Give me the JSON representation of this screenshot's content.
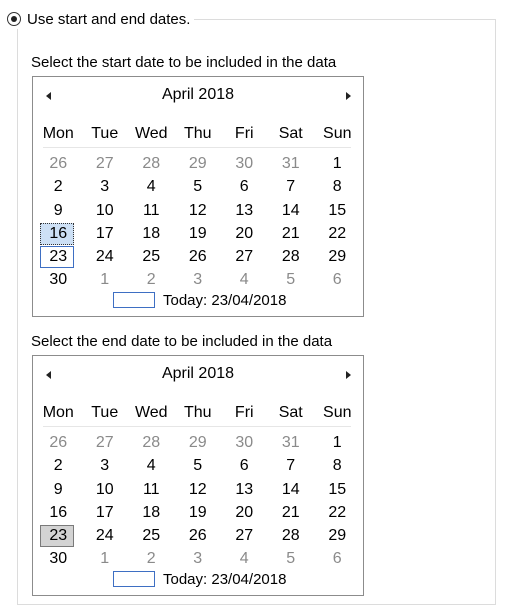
{
  "option": {
    "label": "Use start and end dates."
  },
  "start": {
    "label": "Select the start date to be included in the data",
    "month_title": "April 2018",
    "selected": "16",
    "today_text": "Today: 23/04/2018"
  },
  "end": {
    "label": "Select the end date to be included in the data",
    "month_title": "April 2018",
    "selected": "23",
    "today_text": "Today: 23/04/2018"
  },
  "weekdays": [
    "Mon",
    "Tue",
    "Wed",
    "Thu",
    "Fri",
    "Sat",
    "Sun"
  ],
  "weeks": [
    [
      "26",
      "27",
      "28",
      "29",
      "30",
      "31",
      "1"
    ],
    [
      "2",
      "3",
      "4",
      "5",
      "6",
      "7",
      "8"
    ],
    [
      "9",
      "10",
      "11",
      "12",
      "13",
      "14",
      "15"
    ],
    [
      "16",
      "17",
      "18",
      "19",
      "20",
      "21",
      "22"
    ],
    [
      "23",
      "24",
      "25",
      "26",
      "27",
      "28",
      "29"
    ],
    [
      "30",
      "1",
      "2",
      "3",
      "4",
      "5",
      "6"
    ]
  ],
  "today_day": "23"
}
